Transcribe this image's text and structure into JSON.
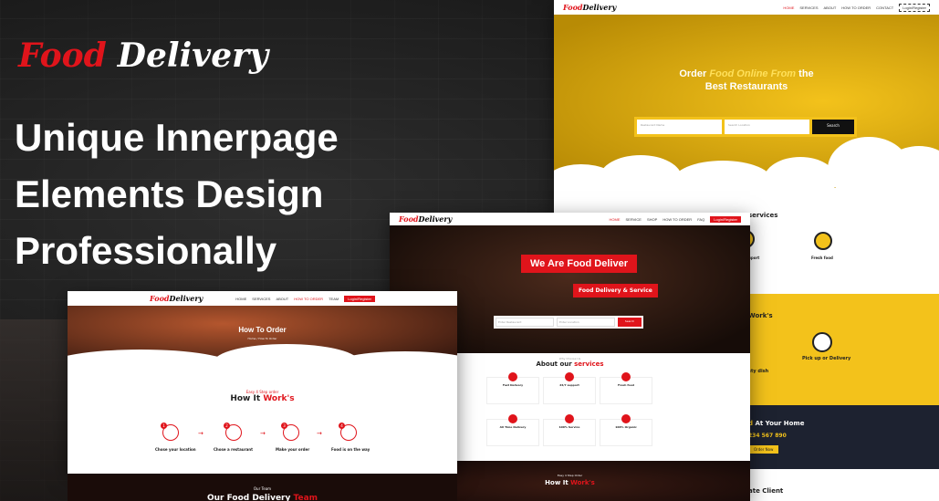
{
  "logo": {
    "part1": "Food",
    "part2": "Delivery"
  },
  "headline": [
    "Unique Innerpage",
    "Elements Design",
    "Professionally"
  ],
  "yellow_mock": {
    "brand_r": "Food",
    "brand": "Delivery",
    "nav": [
      "HOME",
      "SERVICES",
      "ABOUT",
      "HOW TO ORDER",
      "CONTACT"
    ],
    "nav_button": "Login/Register",
    "hero_line1_a": "Order",
    "hero_line1_b": "Food Online From",
    "hero_line1_c": "the",
    "hero_line2": "Best Restaurants",
    "search_placeholder_1": "Restaurant Name",
    "search_placeholder_2": "Search Location",
    "search_button": "Search",
    "services_title": "services",
    "service_labels": [
      "Fresh food"
    ],
    "service_partial": "uport",
    "how_title": "Work's",
    "how_labels": [
      "Pick up or Delivery"
    ],
    "how_partial": "sty dish",
    "home_title_a": "d",
    "home_title_b": "At Your Home",
    "home_phone": "234 567 890",
    "home_button": "Order Now",
    "client": "ate Client"
  },
  "red_mock": {
    "brand_r": "Food",
    "brand": "Delivery",
    "nav": [
      "HOME",
      "SERVICE",
      "SHOP",
      "HOW TO ORDER",
      "FAQ"
    ],
    "nav_button": "Login/Register",
    "banner1": "We Are Food Deliver",
    "banner2": "Food Delivery & Service",
    "search_placeholder_1": "Enter Restaurant",
    "search_placeholder_2": "Enter Location",
    "search_button": "Search",
    "about_sub": "Why Choose Us",
    "about_title_a": "About our",
    "about_title_b": "services",
    "cards": [
      "Fast Delivery",
      "24/7 support",
      "Fresh food",
      "All Time Delivery",
      "100% Service",
      "100% Organic"
    ],
    "how_sub": "Easy 4 Step Order",
    "how_title_a": "How It",
    "how_title_b": "Work's"
  },
  "white_mock": {
    "brand_r": "Food",
    "brand": "Delivery",
    "nav": [
      "HOME",
      "SERVICES",
      "ABOUT",
      "HOW TO ORDER",
      "TEAM"
    ],
    "nav_button": "Login/Register",
    "hero_title": "How To Order",
    "hero_sub": "Home / How To Order",
    "how_sub": "Easy 4 Step order",
    "how_title_a": "How It",
    "how_title_b": "Work's",
    "steps": [
      "Chose your location",
      "Chose a restaurant",
      "Make your order",
      "Food is on the way"
    ],
    "team_sub": "Our Team",
    "team_title_a": "Our Food Delivery",
    "team_title_b": "Team"
  }
}
